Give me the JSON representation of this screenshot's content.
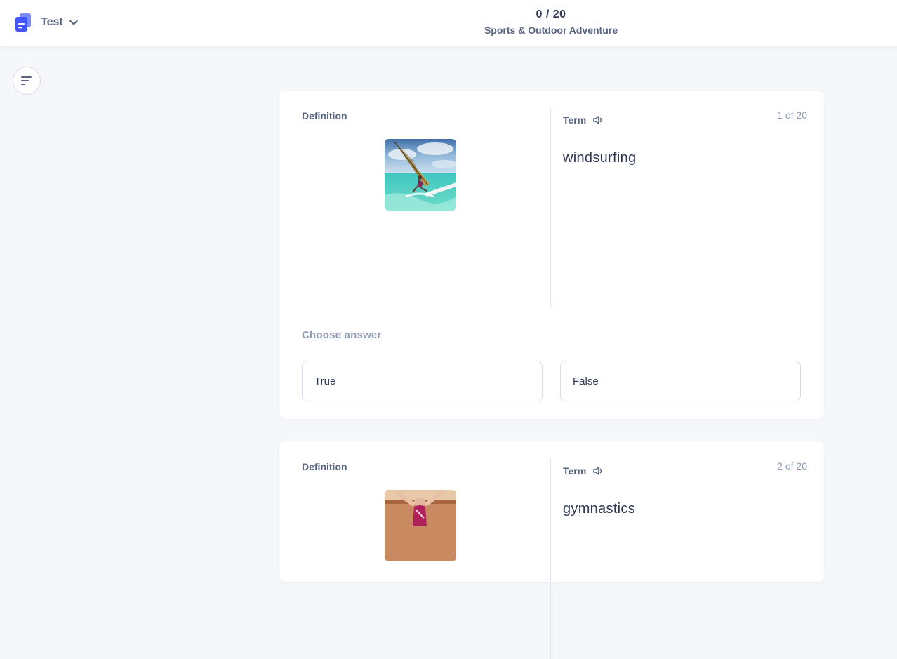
{
  "header": {
    "mode_label": "Test",
    "progress_count": "0 / 20",
    "set_title": "Sports & Outdoor Adventure"
  },
  "icons": {
    "mode": "test-document-icon",
    "chevron": "chevron-down-icon",
    "options": "options-lines-icon",
    "audio": "speaker-icon"
  },
  "colors": {
    "brand": "#4255ff",
    "text": "#2e3856",
    "muted": "#586380",
    "background": "#f6f7fb"
  },
  "questions": [
    {
      "definition_label": "Definition",
      "term_label": "Term",
      "counter": "1 of 20",
      "term": "windsurfing",
      "image": "windsurfer",
      "choose_label": "Choose answer",
      "options": [
        "True",
        "False"
      ]
    },
    {
      "definition_label": "Definition",
      "term_label": "Term",
      "counter": "2 of 20",
      "term": "gymnastics",
      "image": "gymnast"
    }
  ]
}
